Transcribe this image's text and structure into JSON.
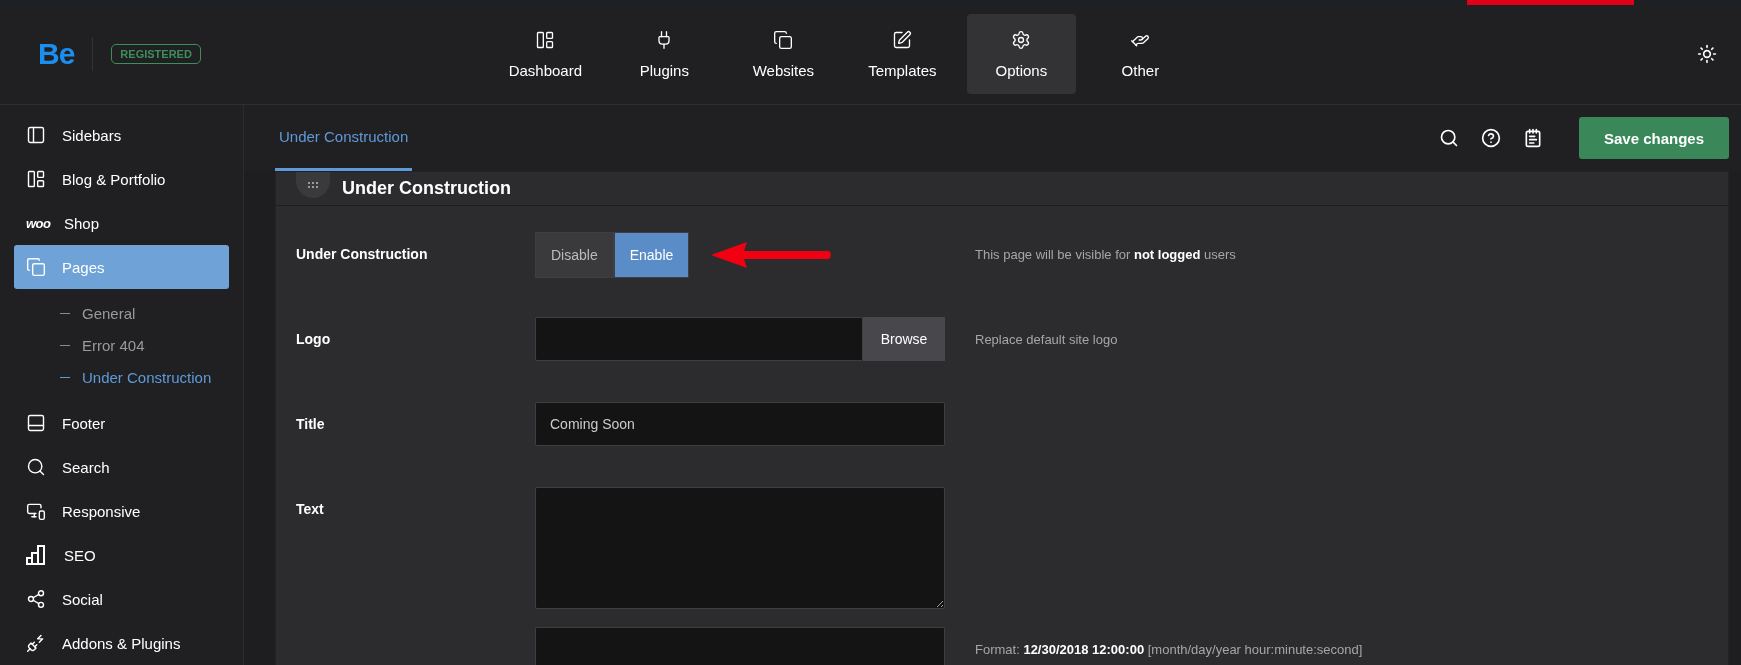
{
  "top_bar": {
    "logo": "Be",
    "badge": "REGISTERED",
    "nav": [
      {
        "label": "Dashboard",
        "selected": false
      },
      {
        "label": "Plugins",
        "selected": false
      },
      {
        "label": "Websites",
        "selected": false
      },
      {
        "label": "Templates",
        "selected": false
      },
      {
        "label": "Options",
        "selected": true
      },
      {
        "label": "Other",
        "selected": false
      }
    ]
  },
  "sidebar": {
    "items": [
      {
        "label": "Sidebars",
        "selected": false
      },
      {
        "label": "Blog & Portfolio",
        "selected": false
      },
      {
        "label": "Shop",
        "selected": false,
        "logo": "woo"
      },
      {
        "label": "Pages",
        "selected": true,
        "children": [
          {
            "label": "General",
            "selected": false
          },
          {
            "label": "Error 404",
            "selected": false
          },
          {
            "label": "Under Construction",
            "selected": true
          }
        ]
      },
      {
        "label": "Footer",
        "selected": false
      },
      {
        "label": "Search",
        "selected": false
      },
      {
        "label": "Responsive",
        "selected": false
      },
      {
        "label": "SEO",
        "selected": false
      },
      {
        "label": "Social",
        "selected": false
      },
      {
        "label": "Addons & Plugins",
        "selected": false
      }
    ]
  },
  "toolbar": {
    "tabs": [
      {
        "label": "Under Construction",
        "selected": true
      }
    ],
    "save_button": "Save changes"
  },
  "panel": {
    "title": "Under Construction",
    "fields": [
      {
        "kind": "toggle",
        "label": "Under Construction",
        "options": [
          {
            "label": "Disable",
            "selected": false
          },
          {
            "label": "Enable",
            "selected": true
          }
        ],
        "hint": "This page will be visible for **not logged** users"
      },
      {
        "kind": "file",
        "label": "Logo",
        "button": "Browse",
        "hint": "Replace default site logo"
      },
      {
        "kind": "text",
        "label": "Title",
        "value": "Coming Soon"
      },
      {
        "kind": "textarea",
        "label": "Text"
      },
      {
        "kind": "text",
        "hint": "Format: **12/30/2018 12:00:00** [month/day/year hour:minute:second]"
      }
    ]
  }
}
